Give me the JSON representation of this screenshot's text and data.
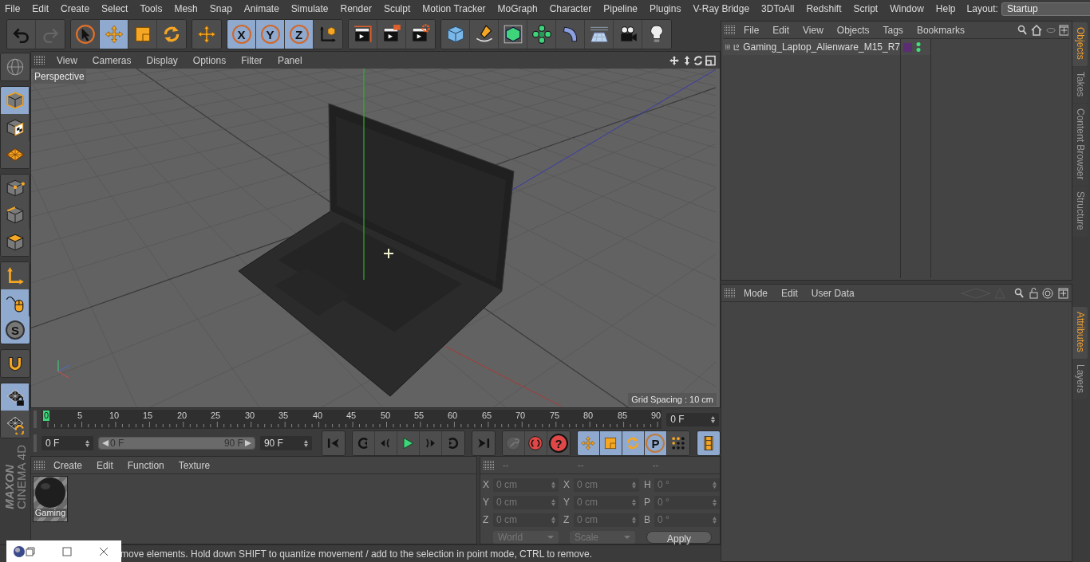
{
  "menu_bar": {
    "items": [
      "File",
      "Edit",
      "Create",
      "Select",
      "Tools",
      "Mesh",
      "Snap",
      "Animate",
      "Simulate",
      "Render",
      "Sculpt",
      "Motion Tracker",
      "MoGraph",
      "Character",
      "Pipeline",
      "Plugins",
      "V-Ray Bridge",
      "3DToAll",
      "Redshift",
      "Script",
      "Window",
      "Help"
    ],
    "layout_label": "Layout:",
    "layout_value": "Startup"
  },
  "toolbar": {
    "groups": [
      {
        "items": [
          {
            "kind": "undo",
            "selected": false
          },
          {
            "kind": "redo",
            "selected": false
          }
        ]
      },
      {
        "items": [
          {
            "kind": "select",
            "selected": false
          },
          {
            "kind": "move",
            "selected": true
          },
          {
            "kind": "scale",
            "selected": false
          },
          {
            "kind": "rotate",
            "selected": false
          }
        ]
      },
      {
        "items": [
          {
            "kind": "move",
            "selected": false
          }
        ]
      },
      {
        "items": [
          {
            "kind": "axis",
            "label": "X",
            "selected": true
          },
          {
            "kind": "axis",
            "label": "Y",
            "selected": true
          },
          {
            "kind": "axis",
            "label": "Z",
            "selected": true
          },
          {
            "kind": "coord",
            "selected": false
          }
        ]
      },
      {
        "items": [
          {
            "kind": "render-view",
            "selected": false
          },
          {
            "kind": "render-picture",
            "selected": false
          },
          {
            "kind": "render-settings",
            "selected": false
          }
        ]
      },
      {
        "items": [
          {
            "kind": "cube",
            "selected": false
          },
          {
            "kind": "pen",
            "selected": false
          },
          {
            "kind": "subdiv",
            "selected": false
          },
          {
            "kind": "cloner",
            "selected": false
          },
          {
            "kind": "bend",
            "selected": false
          },
          {
            "kind": "floor",
            "selected": false
          },
          {
            "kind": "camera",
            "selected": false
          },
          {
            "kind": "light",
            "selected": false
          }
        ]
      }
    ]
  },
  "left_toolbar": {
    "groups": [
      {
        "items": [
          {
            "kind": "globe",
            "selected": false
          }
        ]
      },
      {
        "items": [
          {
            "kind": "model",
            "selected": true
          },
          {
            "kind": "texture",
            "selected": false
          },
          {
            "kind": "workplane",
            "selected": false
          }
        ]
      },
      {
        "items": [
          {
            "kind": "points",
            "selected": false
          },
          {
            "kind": "edges",
            "selected": false
          },
          {
            "kind": "polygons",
            "selected": false
          }
        ]
      },
      {
        "items": [
          {
            "kind": "axis-mode",
            "selected": false
          },
          {
            "kind": "tweak",
            "selected": true
          },
          {
            "kind": "solo",
            "label": "S",
            "selected": true
          }
        ]
      },
      {
        "items": [
          {
            "kind": "magnet",
            "selected": false
          }
        ]
      },
      {
        "items": [
          {
            "kind": "lock-plane",
            "selected": true
          },
          {
            "kind": "sync-plane",
            "selected": false
          }
        ]
      }
    ]
  },
  "logo": {
    "brand": "MAXON",
    "product": "CINEMA 4D"
  },
  "viewport": {
    "menu": [
      "View",
      "Cameras",
      "Display",
      "Options",
      "Filter",
      "Panel"
    ],
    "camera_label": "Perspective",
    "grid_spacing": "Grid Spacing : 10 cm"
  },
  "timeline": {
    "labels": [
      {
        "label": "0",
        "selected": true
      },
      {
        "label": "5",
        "selected": false
      },
      {
        "label": "10",
        "selected": false
      },
      {
        "label": "15",
        "selected": false
      },
      {
        "label": "20",
        "selected": false
      },
      {
        "label": "25",
        "selected": false
      },
      {
        "label": "30",
        "selected": false
      },
      {
        "label": "35",
        "selected": false
      },
      {
        "label": "40",
        "selected": false
      },
      {
        "label": "45",
        "selected": false
      },
      {
        "label": "50",
        "selected": false
      },
      {
        "label": "55",
        "selected": false
      },
      {
        "label": "60",
        "selected": false
      },
      {
        "label": "65",
        "selected": false
      },
      {
        "label": "70",
        "selected": false
      },
      {
        "label": "75",
        "selected": false
      },
      {
        "label": "80",
        "selected": false
      },
      {
        "label": "85",
        "selected": false
      },
      {
        "label": "90",
        "selected": false
      }
    ],
    "current_frame": "0 F"
  },
  "transport": {
    "start": "0 F",
    "range": {
      "start": "0 F",
      "end": "90 F",
      "level": 1
    },
    "end": "90 F",
    "groups": [
      {
        "items": [
          {
            "kind": "first",
            "selected": false
          }
        ]
      },
      {
        "items": [
          {
            "kind": "prev-key",
            "selected": false
          },
          {
            "kind": "prev-frame",
            "selected": false
          },
          {
            "kind": "play",
            "selected": false
          },
          {
            "kind": "next-frame",
            "selected": false
          },
          {
            "kind": "next-key",
            "selected": false
          }
        ]
      },
      {
        "items": [
          {
            "kind": "last",
            "selected": false
          }
        ]
      },
      {
        "items": [
          {
            "kind": "key-off",
            "selected": false
          },
          {
            "kind": "record",
            "selected": false
          },
          {
            "kind": "autokey",
            "label": "?",
            "selected": false
          }
        ]
      },
      {
        "items": [
          {
            "kind": "move",
            "selected": true
          },
          {
            "kind": "scale",
            "selected": true
          },
          {
            "kind": "rotate",
            "selected": true
          },
          {
            "kind": "param",
            "label": "P",
            "selected": true
          },
          {
            "kind": "dots",
            "selected": false
          }
        ]
      },
      {
        "items": [
          {
            "kind": "film",
            "selected": true
          }
        ]
      }
    ]
  },
  "material_manager": {
    "menu": [
      "Create",
      "Edit",
      "Function",
      "Texture"
    ],
    "materials": [
      {
        "name": "Gaming"
      }
    ]
  },
  "coordinates": {
    "headers": [
      "--",
      "--",
      "--"
    ],
    "rows": [
      {
        "axis": "X",
        "position": "0 cm",
        "size_axis": "X",
        "size": "0 cm",
        "rot_axis": "H",
        "rotation": "0 °"
      },
      {
        "axis": "Y",
        "position": "0 cm",
        "size_axis": "Y",
        "size": "0 cm",
        "rot_axis": "P",
        "rotation": "0 °"
      },
      {
        "axis": "Z",
        "position": "0 cm",
        "size_axis": "Z",
        "size": "0 cm",
        "rot_axis": "B",
        "rotation": "0 °"
      }
    ],
    "dropdowns": [
      "World",
      "Scale"
    ],
    "apply": "Apply"
  },
  "status_bar": "move elements. Hold down SHIFT to quantize movement / add to the selection in point mode, CTRL to remove.",
  "object_manager": {
    "menu": [
      "File",
      "Edit",
      "View",
      "Objects",
      "Tags",
      "Bookmarks"
    ],
    "objects": [
      {
        "name": "Gaming_Laptop_Alienware_M15_R7",
        "expanded": false,
        "color": "#5b2d72"
      }
    ]
  },
  "attributes": {
    "menu": [
      "Mode",
      "Edit",
      "User Data"
    ]
  },
  "side_tabs_top": [
    {
      "label": "Objects",
      "selected": true
    },
    {
      "label": "Takes",
      "selected": false
    },
    {
      "label": "Content Browser",
      "selected": false
    },
    {
      "label": "Structure",
      "selected": false
    }
  ],
  "side_tabs_bottom": [
    {
      "label": "Attributes",
      "selected": true
    },
    {
      "label": "Layers",
      "selected": false
    }
  ]
}
